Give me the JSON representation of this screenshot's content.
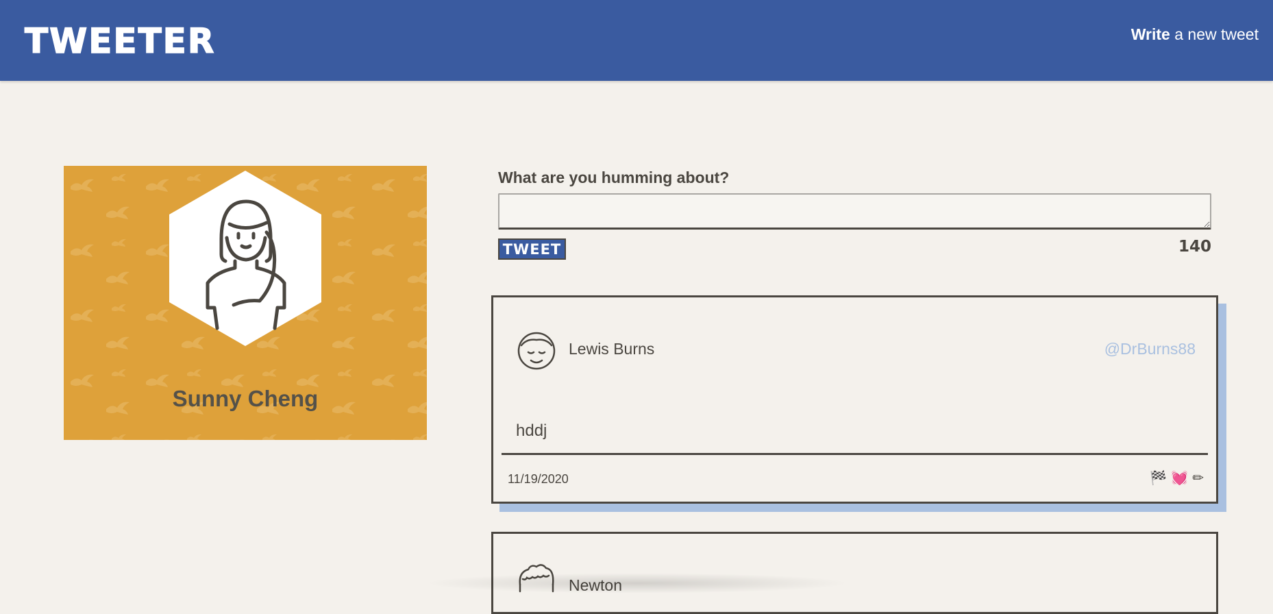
{
  "nav": {
    "brand": "TWEETER",
    "compose_bold": "Write",
    "compose_rest": " a new tweet"
  },
  "profile": {
    "name": "Sunny Cheng",
    "banner_color": "#dea13a"
  },
  "compose": {
    "label": "What are you humming about?",
    "value": "",
    "placeholder": "",
    "button_label": "TWEET",
    "counter": "140"
  },
  "tweets": [
    {
      "author": "Lewis Burns",
      "handle": "@DrBurns88",
      "content": "hddj",
      "date": "11/19/2020",
      "actions": [
        "🏁",
        "💓",
        "✏"
      ]
    },
    {
      "author": "Newton",
      "handle": "",
      "content": "",
      "date": "",
      "actions": []
    }
  ],
  "colors": {
    "header": "#3a5ba0",
    "background": "#f4f1ec",
    "handle": "#a9c0e0",
    "card_shadow": "#a9c0e0",
    "text": "#4a4640"
  },
  "icons": {
    "profile_avatar": "woman-avatar-icon",
    "tweet_avatar": "man-avatar-icon",
    "tweet_actions": [
      "flag-icon",
      "heart-icon",
      "pencil-icon"
    ]
  }
}
